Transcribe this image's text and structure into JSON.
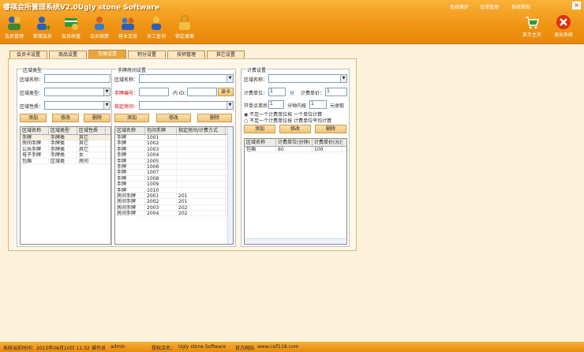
{
  "app": {
    "title": "睿祺会所管理系统V2.0Ugly  stone Software"
  },
  "topmenu": [
    "系统维护",
    "日常管理",
    "系统帮助"
  ],
  "toolbar": [
    "会员管理",
    "新增会员",
    "会员续值",
    "会员续费",
    "营业交班",
    "员工查询",
    "锁定桌面"
  ],
  "toolbar_right": [
    "显示主页",
    "退出系统"
  ],
  "tabs": [
    "会员卡设置",
    "商品设置",
    "包厢设置",
    "积分设置",
    "技师管理",
    "其它设置"
  ],
  "area": {
    "group": "区域类型",
    "name_label": "区域名称：",
    "type_label": "区域类型：",
    "nature_label": "区域性质：",
    "add": "添加",
    "edit": "修改",
    "del": "删除",
    "headers": [
      "区域名称",
      "区域类型",
      "区域性质"
    ],
    "rows": [
      [
        "手牌",
        "手牌类",
        "其它"
      ],
      [
        "房间手牌",
        "手牌类",
        "其它"
      ],
      [
        "公共手牌",
        "手牌类",
        "其它"
      ],
      [
        "母子手牌",
        "手牌类",
        "女"
      ],
      [
        "包厢",
        "区域类",
        "房间"
      ]
    ]
  },
  "hand": {
    "group": "手牌房间设置",
    "name_label": "区域名称：",
    "no_label": "手牌编号：",
    "id_label": "内 ID：",
    "read": "读卡",
    "room_label": "指定房间：",
    "add": "添加",
    "edit": "修改",
    "del": "删除",
    "headers": [
      "区域名称",
      "包间手牌",
      "指定房间/计费方式"
    ],
    "rows": [
      [
        "手牌",
        "1001",
        ""
      ],
      [
        "手牌",
        "1002",
        ""
      ],
      [
        "手牌",
        "1003",
        ""
      ],
      [
        "手牌",
        "1004",
        ""
      ],
      [
        "手牌",
        "1005",
        ""
      ],
      [
        "手牌",
        "1006",
        ""
      ],
      [
        "手牌",
        "1007",
        ""
      ],
      [
        "手牌",
        "1008",
        ""
      ],
      [
        "手牌",
        "1009",
        ""
      ],
      [
        "手牌",
        "1010",
        ""
      ],
      [
        "房间手牌",
        "2001",
        "201"
      ],
      [
        "房间手牌",
        "2002",
        "201"
      ],
      [
        "房间手牌",
        "2003",
        "202"
      ],
      [
        "房间手牌",
        "2004",
        "202"
      ]
    ]
  },
  "fee": {
    "group": "计费设置",
    "name_label": "区域名称：",
    "unit_label": "计费单位：",
    "unit_val": "1",
    "unit_suffix": "分",
    "price_label": "计费单价：",
    "price_val": "1",
    "start_label": "开单点单后",
    "start_val": "1",
    "start_mid": "分钟内按",
    "start_val2": "1",
    "start_suffix": "元收取",
    "opt1": "不足一个计费单位按 一个单位计算",
    "opt2": "不足一个计费单位按 计费单位平均计算",
    "add": "添加",
    "edit": "修改",
    "del": "删除",
    "headers": [
      "区域名称",
      "计费单位(分钟)",
      "计费单价(元)"
    ],
    "rows": [
      [
        "包厢",
        "60",
        "100"
      ]
    ]
  },
  "status": {
    "time_label": "系统当前时间：",
    "time": "2015年06月10日 11:32",
    "op_label": "操作员",
    "op": "admin",
    "auth_label": "授权店名：",
    "auth": "Ugly  stone Software",
    "site_label": "官方网站",
    "site": "www.csif118.com"
  },
  "colors": {
    "header": "#f09312",
    "accent": "#e8a540",
    "panel": "#fff8ea"
  }
}
